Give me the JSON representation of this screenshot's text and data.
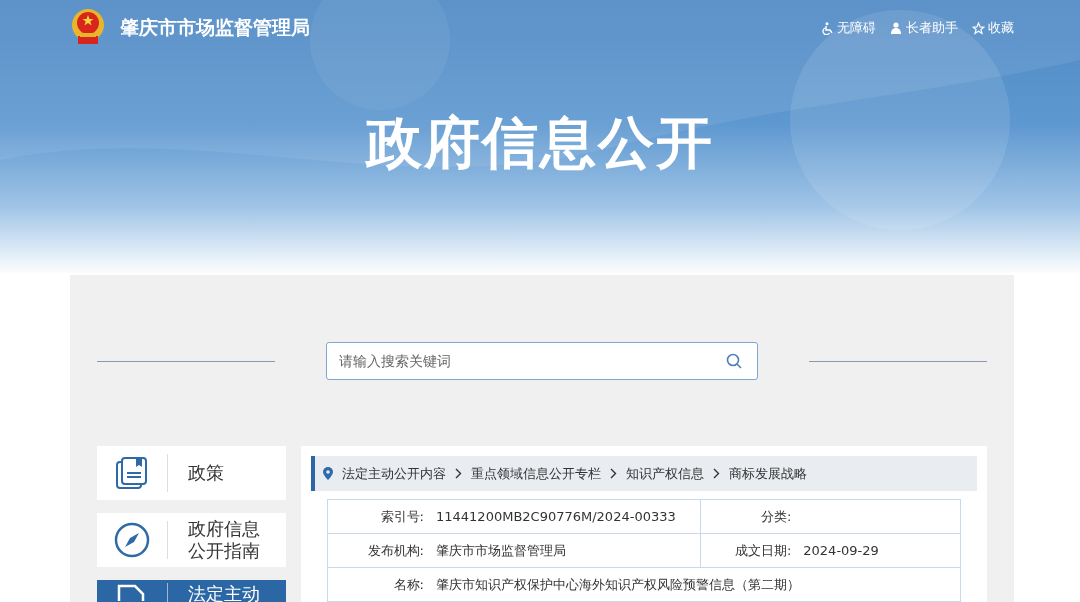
{
  "header": {
    "site_title": "肇庆市市场监督管理局",
    "tools": [
      {
        "kind": "accessibility",
        "label": "无障碍"
      },
      {
        "kind": "elder",
        "label": "长者助手"
      },
      {
        "kind": "favorite",
        "label": "收藏"
      }
    ],
    "banner_title": "政府信息公开"
  },
  "search": {
    "placeholder": "请输入搜索关键词"
  },
  "sidebar": {
    "items": [
      {
        "kind": "policy",
        "lines": [
          "政策"
        ],
        "selected": false
      },
      {
        "kind": "guide",
        "lines": [
          "政府信息",
          "公开指南"
        ],
        "selected": false
      },
      {
        "kind": "content",
        "lines": [
          "法定主动"
        ],
        "selected": true
      }
    ]
  },
  "breadcrumb": [
    "法定主动公开内容",
    "重点领域信息公开专栏",
    "知识产权信息",
    "商标发展战略"
  ],
  "info_table": {
    "rows": [
      {
        "cells": [
          {
            "label": "索引号:",
            "value": "11441200MB2C90776M/2024-00333"
          },
          {
            "label": "分类:"
          }
        ]
      },
      {
        "cells": [
          {
            "label": "发布机构:",
            "value": "肇庆市市场监督管理局"
          },
          {
            "label": "成文日期:",
            "value": "2024-09-29"
          }
        ]
      },
      {
        "cells": [
          {
            "label": "名称:",
            "value": "肇庆市知识产权保护中心海外知识产权风险预警信息（第二期）"
          }
        ]
      }
    ]
  }
}
